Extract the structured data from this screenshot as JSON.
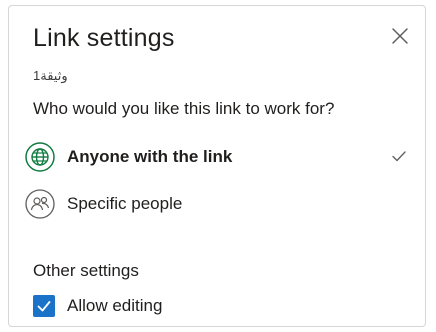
{
  "dialog": {
    "title": "Link settings",
    "subtitle": "وثيقة1",
    "close_icon": "close-icon",
    "question": "Who would you like this link to work for?"
  },
  "options": [
    {
      "label": "Anyone with the link",
      "icon": "globe-icon",
      "selected": true,
      "icon_color": "#107c41"
    },
    {
      "label": "Specific people",
      "icon": "people-icon",
      "selected": false,
      "icon_color": "#605e5c"
    }
  ],
  "other_settings": {
    "heading": "Other settings",
    "allow_editing": {
      "label": "Allow editing",
      "checked": true
    }
  },
  "colors": {
    "accent": "#1a73c9",
    "globe_green": "#107c41",
    "text": "#201f1e",
    "border": "#d6d6d6"
  }
}
